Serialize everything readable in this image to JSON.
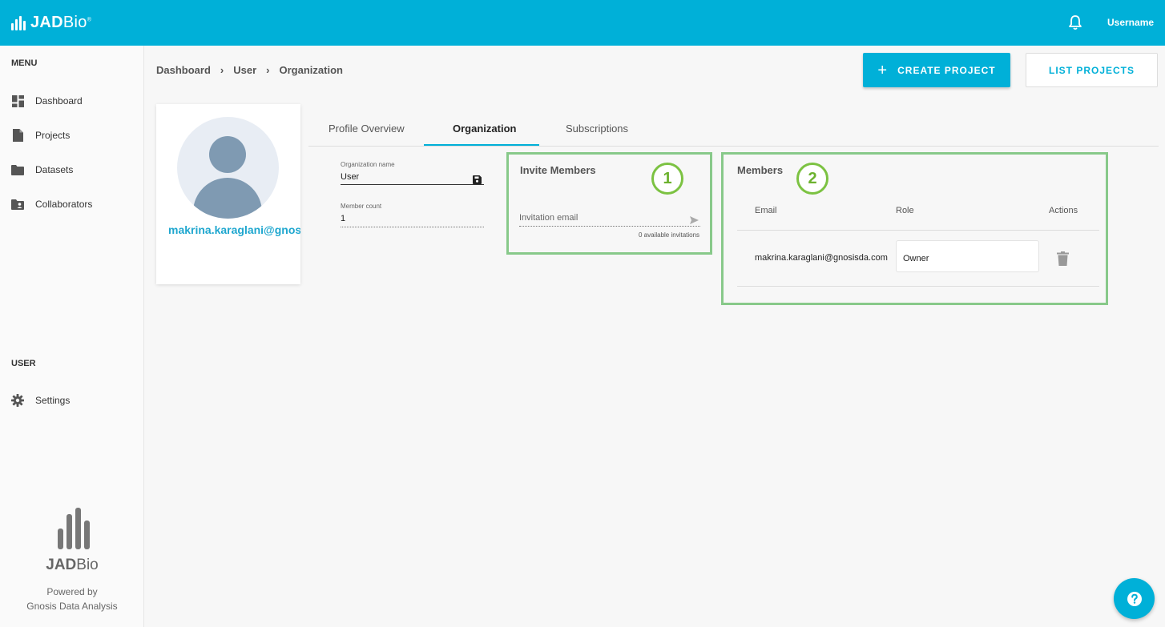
{
  "app": {
    "brand_bold": "JAD",
    "brand_light": "Bio",
    "brand_mark": "®"
  },
  "header": {
    "username": "Username",
    "notification_icon": "bell-icon"
  },
  "sidebar": {
    "menu_heading": "MENU",
    "items": [
      {
        "label": "Dashboard",
        "icon": "dashboard-icon"
      },
      {
        "label": "Projects",
        "icon": "file-icon"
      },
      {
        "label": "Datasets",
        "icon": "folder-icon"
      },
      {
        "label": "Collaborators",
        "icon": "shared-folder-icon"
      }
    ],
    "user_heading": "USER",
    "user_items": [
      {
        "label": "Settings",
        "icon": "gear-icon"
      }
    ],
    "footer": {
      "brand_bold": "JAD",
      "brand_light": "Bio",
      "powered_line1": "Powered by",
      "powered_line2": "Gnosis Data Analysis"
    }
  },
  "breadcrumb": [
    "Dashboard",
    "User",
    "Organization"
  ],
  "actions": {
    "create_project": "CREATE PROJECT",
    "list_projects": "LIST PROJECTS"
  },
  "profile": {
    "email": "makrina.karaglani@gnosisda.com"
  },
  "tabs": [
    {
      "label": "Profile Overview",
      "active": false
    },
    {
      "label": "Organization",
      "active": true
    },
    {
      "label": "Subscriptions",
      "active": false
    }
  ],
  "organization": {
    "name_label": "Organization name",
    "name_value": "User",
    "member_count_label": "Member count",
    "member_count_value": "1"
  },
  "invite": {
    "title": "Invite Members",
    "badge": "1",
    "email_placeholder": "Invitation email",
    "available": "0 available invitations"
  },
  "members": {
    "title": "Members",
    "badge": "2",
    "columns": [
      "Email",
      "Role",
      "Actions"
    ],
    "rows": [
      {
        "email": "makrina.karaglani@gnosisda.com",
        "role": "Owner"
      }
    ]
  },
  "colors": {
    "primary": "#00b0d8",
    "highlight_border": "#88c98a",
    "badge_green": "#7cc242"
  }
}
